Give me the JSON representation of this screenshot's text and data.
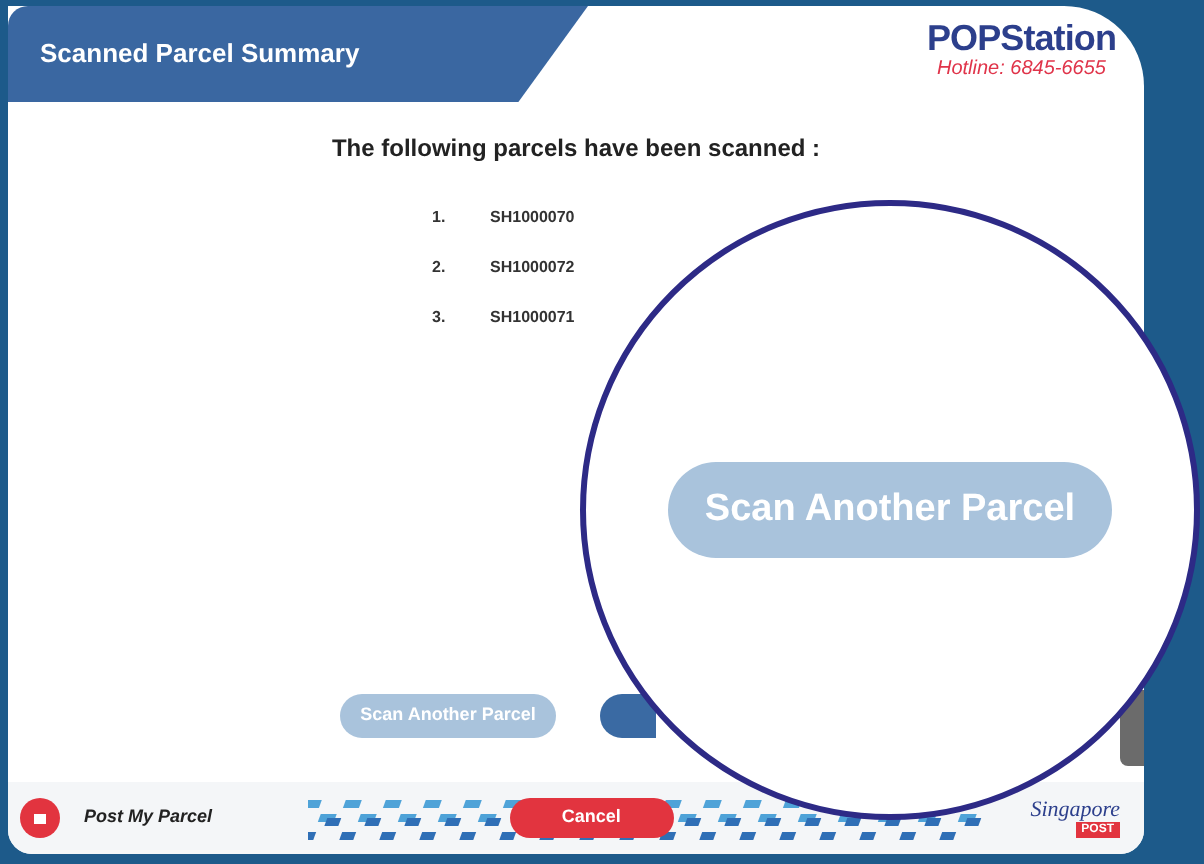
{
  "header": {
    "title": "Scanned Parcel Summary"
  },
  "logo": {
    "name": "POPStation",
    "hotline": "Hotline: 6845-6655"
  },
  "heading": "The following parcels have been scanned :",
  "parcels": [
    {
      "number": "1.",
      "code": "SH1000070"
    },
    {
      "number": "2.",
      "code": "SH1000072"
    },
    {
      "number": "3.",
      "code": "SH1000071"
    }
  ],
  "buttons": [
    {
      "kind": "secondary",
      "label": "Scan Another Parcel"
    },
    {
      "kind": "primary"
    }
  ],
  "footer": {
    "service": "Post My Parcel",
    "cancel": "Cancel",
    "brand": "Singapore",
    "brand_tag": "POST"
  },
  "magnifier": {
    "label": "Scan Another Parcel"
  }
}
